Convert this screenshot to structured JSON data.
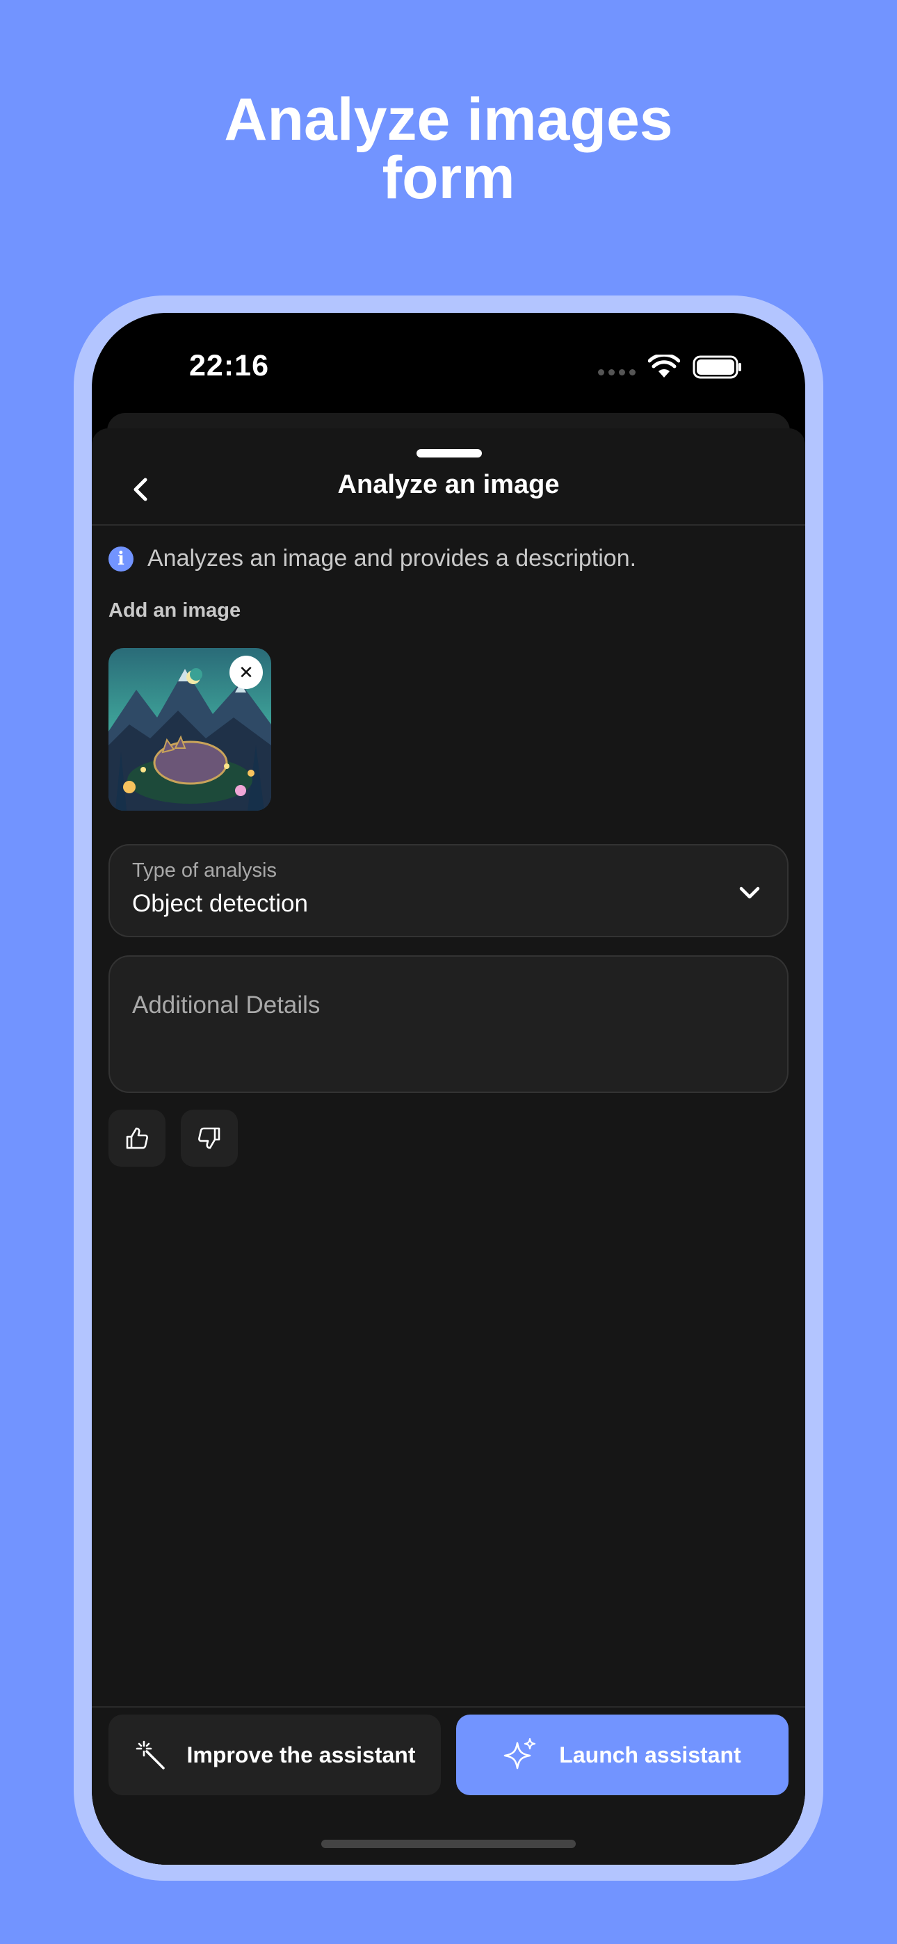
{
  "headline": {
    "line1": "Analyze images",
    "line2": "form"
  },
  "status_bar": {
    "time": "22:16",
    "icons": [
      "signal-dots-icon",
      "wifi-icon",
      "battery-icon"
    ]
  },
  "sheet": {
    "title": "Analyze an image",
    "back_icon": "chevron-left-icon",
    "info_text": "Analyzes an image and provides a description.",
    "info_icon": "info-icon",
    "image_section_label": "Add an image",
    "image_remove_icon": "close-icon",
    "analysis_select": {
      "label": "Type of analysis",
      "value": "Object detection",
      "icon": "chevron-down-icon"
    },
    "details_field": {
      "placeholder": "Additional Details",
      "value": ""
    },
    "feedback": {
      "like_icon": "thumbs-up-icon",
      "dislike_icon": "thumbs-down-icon"
    }
  },
  "actions": {
    "improve": {
      "label": "Improve the assistant",
      "icon": "magic-wand-icon"
    },
    "launch": {
      "label": "Launch assistant",
      "icon": "sparkles-icon"
    }
  },
  "colors": {
    "background": "#7294ff",
    "accent": "#7294ff",
    "frame": "#b3c5ff",
    "sheet": "#161616"
  }
}
